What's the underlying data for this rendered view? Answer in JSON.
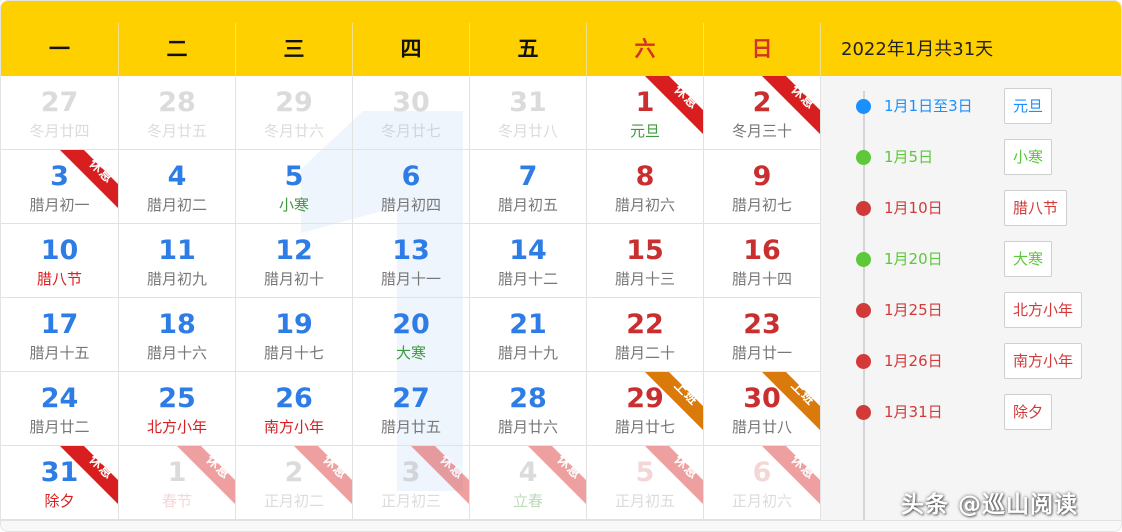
{
  "header": {
    "weekdays": [
      "一",
      "二",
      "三",
      "四",
      "五",
      "六",
      "日"
    ],
    "month_title": "2022年1月共31天"
  },
  "colors": {
    "header_bg": "#ffd000",
    "weekday_blue": "#2e7de6",
    "weekend_red": "#c92f2f",
    "rest_ribbon": "#d81e1e",
    "work_ribbon": "#d97a0b",
    "sidebar_bg": "#f5f5f5"
  },
  "background_digit": "1",
  "calendar": {
    "rows": [
      [
        {
          "day": "27",
          "lunar": "冬月廿四",
          "other": true,
          "weekend": false,
          "lunar_style": "normal"
        },
        {
          "day": "28",
          "lunar": "冬月廿五",
          "other": true,
          "weekend": false,
          "lunar_style": "normal"
        },
        {
          "day": "29",
          "lunar": "冬月廿六",
          "other": true,
          "weekend": false,
          "lunar_style": "normal"
        },
        {
          "day": "30",
          "lunar": "冬月廿七",
          "other": true,
          "weekend": false,
          "lunar_style": "normal"
        },
        {
          "day": "31",
          "lunar": "冬月廿八",
          "other": true,
          "weekend": false,
          "lunar_style": "normal"
        },
        {
          "day": "1",
          "lunar": "元旦",
          "other": false,
          "weekend": true,
          "lunar_style": "green",
          "badge": "休息",
          "badge_type": "rest"
        },
        {
          "day": "2",
          "lunar": "冬月三十",
          "other": false,
          "weekend": true,
          "lunar_style": "normal",
          "badge": "休息",
          "badge_type": "rest"
        }
      ],
      [
        {
          "day": "3",
          "lunar": "腊月初一",
          "other": false,
          "weekend": false,
          "lunar_style": "normal",
          "badge": "休息",
          "badge_type": "rest"
        },
        {
          "day": "4",
          "lunar": "腊月初二",
          "other": false,
          "weekend": false,
          "lunar_style": "normal"
        },
        {
          "day": "5",
          "lunar": "小寒",
          "other": false,
          "weekend": false,
          "lunar_style": "green"
        },
        {
          "day": "6",
          "lunar": "腊月初四",
          "other": false,
          "weekend": false,
          "lunar_style": "normal"
        },
        {
          "day": "7",
          "lunar": "腊月初五",
          "other": false,
          "weekend": false,
          "lunar_style": "normal"
        },
        {
          "day": "8",
          "lunar": "腊月初六",
          "other": false,
          "weekend": true,
          "lunar_style": "normal"
        },
        {
          "day": "9",
          "lunar": "腊月初七",
          "other": false,
          "weekend": true,
          "lunar_style": "normal"
        }
      ],
      [
        {
          "day": "10",
          "lunar": "腊八节",
          "other": false,
          "weekend": false,
          "lunar_style": "red"
        },
        {
          "day": "11",
          "lunar": "腊月初九",
          "other": false,
          "weekend": false,
          "lunar_style": "normal"
        },
        {
          "day": "12",
          "lunar": "腊月初十",
          "other": false,
          "weekend": false,
          "lunar_style": "normal"
        },
        {
          "day": "13",
          "lunar": "腊月十一",
          "other": false,
          "weekend": false,
          "lunar_style": "normal"
        },
        {
          "day": "14",
          "lunar": "腊月十二",
          "other": false,
          "weekend": false,
          "lunar_style": "normal"
        },
        {
          "day": "15",
          "lunar": "腊月十三",
          "other": false,
          "weekend": true,
          "lunar_style": "normal"
        },
        {
          "day": "16",
          "lunar": "腊月十四",
          "other": false,
          "weekend": true,
          "lunar_style": "normal"
        }
      ],
      [
        {
          "day": "17",
          "lunar": "腊月十五",
          "other": false,
          "weekend": false,
          "lunar_style": "normal"
        },
        {
          "day": "18",
          "lunar": "腊月十六",
          "other": false,
          "weekend": false,
          "lunar_style": "normal"
        },
        {
          "day": "19",
          "lunar": "腊月十七",
          "other": false,
          "weekend": false,
          "lunar_style": "normal"
        },
        {
          "day": "20",
          "lunar": "大寒",
          "other": false,
          "weekend": false,
          "lunar_style": "green"
        },
        {
          "day": "21",
          "lunar": "腊月十九",
          "other": false,
          "weekend": false,
          "lunar_style": "normal"
        },
        {
          "day": "22",
          "lunar": "腊月二十",
          "other": false,
          "weekend": true,
          "lunar_style": "normal"
        },
        {
          "day": "23",
          "lunar": "腊月廿一",
          "other": false,
          "weekend": true,
          "lunar_style": "normal"
        }
      ],
      [
        {
          "day": "24",
          "lunar": "腊月廿二",
          "other": false,
          "weekend": false,
          "lunar_style": "normal"
        },
        {
          "day": "25",
          "lunar": "北方小年",
          "other": false,
          "weekend": false,
          "lunar_style": "red"
        },
        {
          "day": "26",
          "lunar": "南方小年",
          "other": false,
          "weekend": false,
          "lunar_style": "red"
        },
        {
          "day": "27",
          "lunar": "腊月廿五",
          "other": false,
          "weekend": false,
          "lunar_style": "normal"
        },
        {
          "day": "28",
          "lunar": "腊月廿六",
          "other": false,
          "weekend": false,
          "lunar_style": "normal"
        },
        {
          "day": "29",
          "lunar": "腊月廿七",
          "other": false,
          "weekend": true,
          "lunar_style": "normal",
          "badge": "上班",
          "badge_type": "work"
        },
        {
          "day": "30",
          "lunar": "腊月廿八",
          "other": false,
          "weekend": true,
          "lunar_style": "normal",
          "badge": "上班",
          "badge_type": "work"
        }
      ],
      [
        {
          "day": "31",
          "lunar": "除夕",
          "other": false,
          "weekend": false,
          "lunar_style": "red",
          "badge": "休息",
          "badge_type": "rest"
        },
        {
          "day": "1",
          "lunar": "春节",
          "other": true,
          "weekend": false,
          "lunar_style": "pink",
          "badge": "休息",
          "badge_type": "rest"
        },
        {
          "day": "2",
          "lunar": "正月初二",
          "other": true,
          "weekend": false,
          "lunar_style": "normal",
          "badge": "休息",
          "badge_type": "rest"
        },
        {
          "day": "3",
          "lunar": "正月初三",
          "other": true,
          "weekend": false,
          "lunar_style": "normal",
          "badge": "休息",
          "badge_type": "rest"
        },
        {
          "day": "4",
          "lunar": "立春",
          "other": true,
          "weekend": false,
          "lunar_style": "green",
          "badge": "休息",
          "badge_type": "rest"
        },
        {
          "day": "5",
          "lunar": "正月初五",
          "other": true,
          "weekend": true,
          "lunar_style": "normal",
          "badge": "休息",
          "badge_type": "rest"
        },
        {
          "day": "6",
          "lunar": "正月初六",
          "other": true,
          "weekend": true,
          "lunar_style": "normal",
          "badge": "休息",
          "badge_type": "rest"
        }
      ]
    ]
  },
  "events": [
    {
      "date": "1月1日至3日",
      "name": "元旦",
      "color": "#1890ff"
    },
    {
      "date": "1月5日",
      "name": "小寒",
      "color": "#5cc83a"
    },
    {
      "date": "1月10日",
      "name": "腊八节",
      "color": "#d23a3a"
    },
    {
      "date": "1月20日",
      "name": "大寒",
      "color": "#5cc83a"
    },
    {
      "date": "1月25日",
      "name": "北方小年",
      "color": "#d23a3a"
    },
    {
      "date": "1月26日",
      "name": "南方小年",
      "color": "#d23a3a"
    },
    {
      "date": "1月31日",
      "name": "除夕",
      "color": "#d23a3a"
    }
  ],
  "watermark": "头条 @巡山阅读"
}
